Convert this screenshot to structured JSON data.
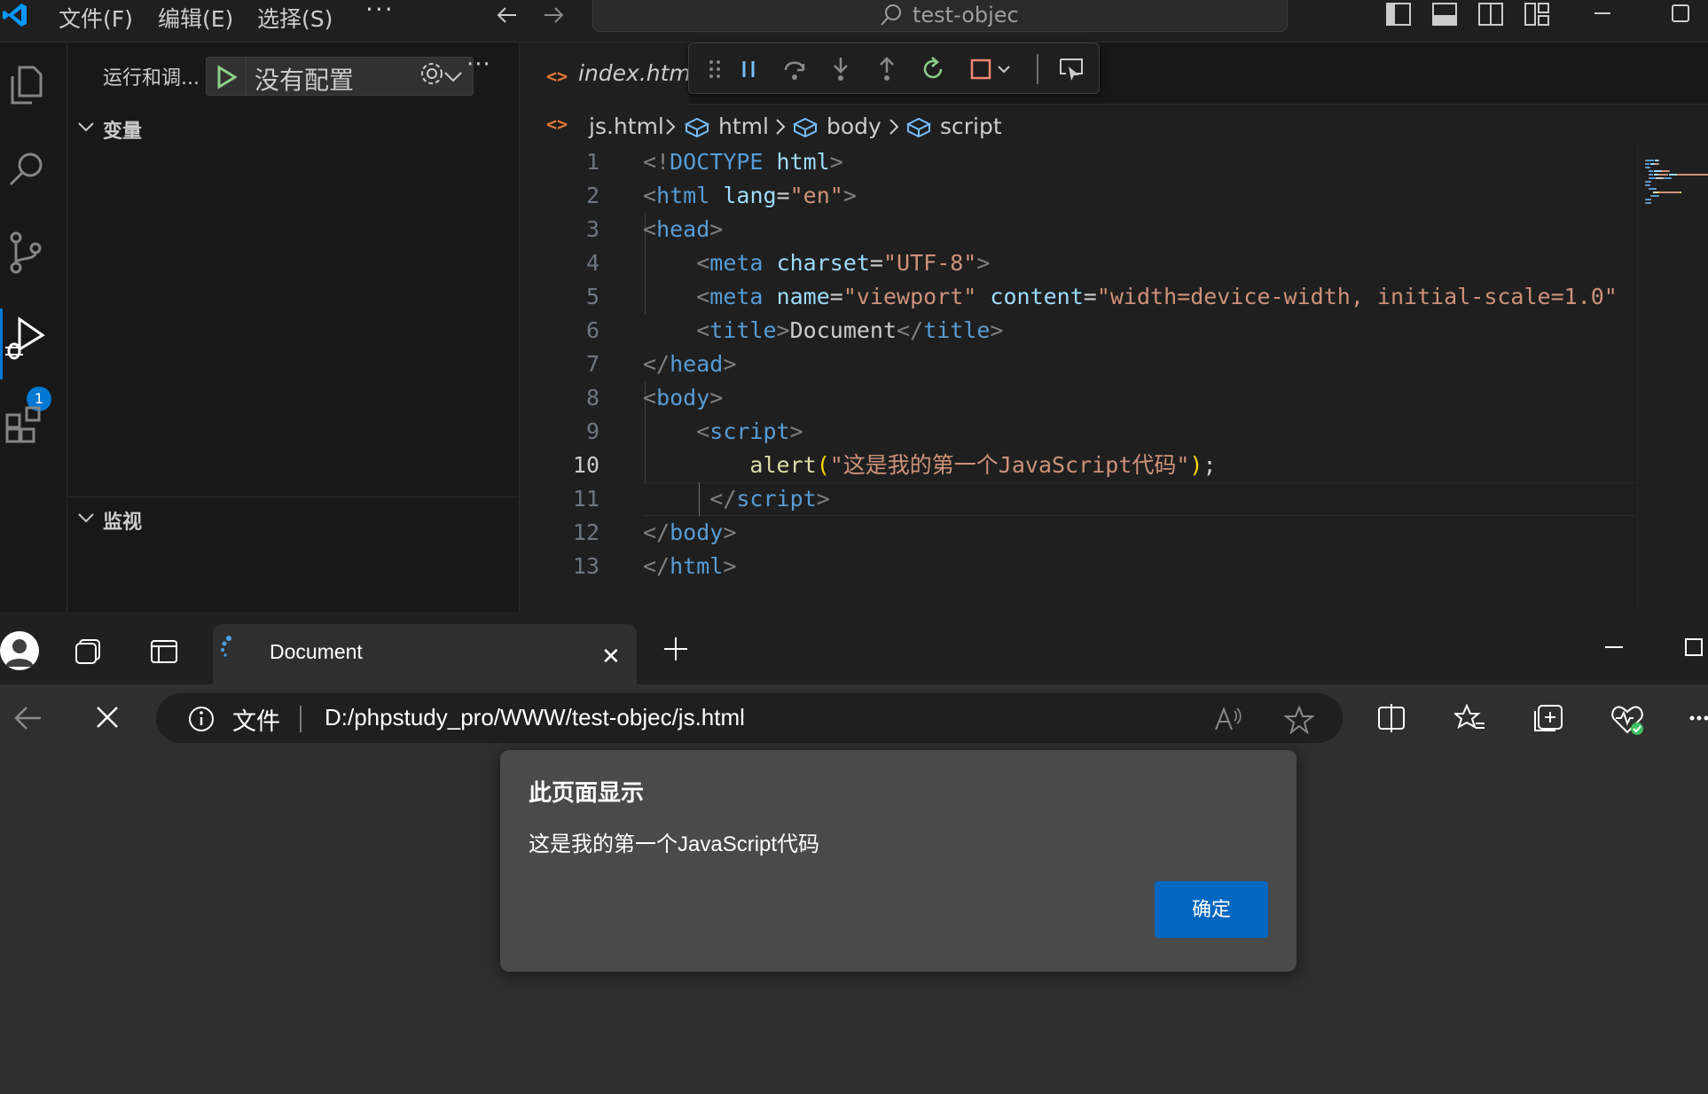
{
  "vscode": {
    "menu": [
      {
        "label": "文件(F)"
      },
      {
        "label": "编辑(E)"
      },
      {
        "label": "选择(S)"
      }
    ],
    "menu_more": "···",
    "command_center": "test-objec",
    "activity_badge": "1",
    "sidebar": {
      "title": "运行和调...",
      "run_config": "没有配置",
      "more": "···",
      "sections": {
        "variables": "变量",
        "watch": "监视"
      }
    },
    "tab": {
      "icon": "<>",
      "label": "index.html"
    },
    "breadcrumb": {
      "file": "js.html",
      "items": [
        "html",
        "body",
        "script"
      ]
    },
    "code": {
      "active_line": 10,
      "line_numbers": [
        "1",
        "2",
        "3",
        "4",
        "5",
        "6",
        "7",
        "8",
        "9",
        "10",
        "11",
        "12",
        "13"
      ],
      "lines": [
        [
          [
            "punc",
            "<!"
          ],
          [
            "tag",
            "DOCTYPE"
          ],
          [
            "text",
            " "
          ],
          [
            "attr",
            "html"
          ],
          [
            "punc",
            ">"
          ]
        ],
        [
          [
            "punc",
            "<"
          ],
          [
            "tag",
            "html"
          ],
          [
            "text",
            " "
          ],
          [
            "attr",
            "lang"
          ],
          [
            "text",
            "="
          ],
          [
            "str",
            "\"en\""
          ],
          [
            "punc",
            ">"
          ]
        ],
        [
          [
            "punc",
            "<"
          ],
          [
            "tag",
            "head"
          ],
          [
            "punc",
            ">"
          ]
        ],
        [
          [
            "text",
            "    "
          ],
          [
            "punc",
            "<"
          ],
          [
            "tag",
            "meta"
          ],
          [
            "text",
            " "
          ],
          [
            "attr",
            "charset"
          ],
          [
            "text",
            "="
          ],
          [
            "str",
            "\"UTF-8\""
          ],
          [
            "punc",
            ">"
          ]
        ],
        [
          [
            "text",
            "    "
          ],
          [
            "punc",
            "<"
          ],
          [
            "tag",
            "meta"
          ],
          [
            "text",
            " "
          ],
          [
            "attr",
            "name"
          ],
          [
            "text",
            "="
          ],
          [
            "str",
            "\"viewport\""
          ],
          [
            "text",
            " "
          ],
          [
            "attr",
            "content"
          ],
          [
            "text",
            "="
          ],
          [
            "str",
            "\"width=device-width, initial-scale=1.0\""
          ]
        ],
        [
          [
            "text",
            "    "
          ],
          [
            "punc",
            "<"
          ],
          [
            "tag",
            "title"
          ],
          [
            "punc",
            ">"
          ],
          [
            "text",
            "Document"
          ],
          [
            "punc",
            "</"
          ],
          [
            "tag",
            "title"
          ],
          [
            "punc",
            ">"
          ]
        ],
        [
          [
            "punc",
            "</"
          ],
          [
            "tag",
            "head"
          ],
          [
            "punc",
            ">"
          ]
        ],
        [
          [
            "punc",
            "<"
          ],
          [
            "tag",
            "body"
          ],
          [
            "punc",
            ">"
          ]
        ],
        [
          [
            "text",
            "    "
          ],
          [
            "punc",
            "<"
          ],
          [
            "tag",
            "script"
          ],
          [
            "punc",
            ">"
          ]
        ],
        [
          [
            "text",
            "        "
          ],
          [
            "fn",
            "alert"
          ],
          [
            "paren",
            "("
          ],
          [
            "str",
            "\"这是我的第一个JavaScript代码\""
          ],
          [
            "paren",
            ")"
          ],
          [
            "text",
            ";"
          ]
        ],
        [
          [
            "text",
            "     "
          ],
          [
            "punc",
            "</"
          ],
          [
            "tag",
            "script"
          ],
          [
            "punc",
            ">"
          ]
        ],
        [
          [
            "punc",
            "</"
          ],
          [
            "tag",
            "body"
          ],
          [
            "punc",
            ">"
          ]
        ],
        [
          [
            "punc",
            "</"
          ],
          [
            "tag",
            "html"
          ],
          [
            "punc",
            ">"
          ]
        ]
      ]
    }
  },
  "browser": {
    "tab_title": "Document",
    "tab_close": "✕",
    "new_tab": "+",
    "address": {
      "scheme_label": "文件",
      "url": "D:/phpstudy_pro/WWW/test-objec/js.html"
    },
    "dialog": {
      "title": "此页面显示",
      "message": "这是我的第一个JavaScript代码",
      "ok": "确定"
    }
  }
}
